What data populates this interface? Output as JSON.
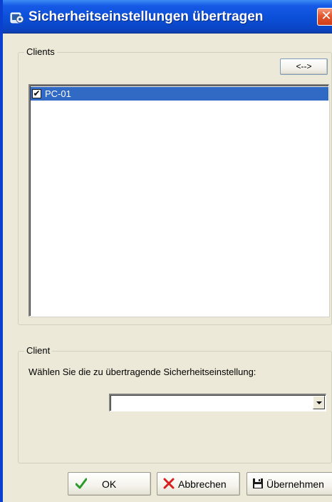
{
  "window": {
    "title": "Sicherheitseinstellungen übertragen",
    "close_glyph": "✕"
  },
  "clients_group": {
    "legend": "Clients",
    "swap_button_label": "<-->",
    "items": [
      {
        "label": "PC-01",
        "checked": true,
        "selected": true
      }
    ]
  },
  "client_group": {
    "legend": "Client",
    "prompt": "Wählen Sie die zu übertragende Sicherheitseinstellung:",
    "selected_value": ""
  },
  "buttons": {
    "ok_label": "OK",
    "cancel_label": "Abbrechen",
    "apply_label": "Übernehmen"
  },
  "colors": {
    "titlebar": "#0b4fd8",
    "selection": "#316ac5",
    "ok_icon": "#2a9b2a",
    "cancel_icon": "#d61f1f"
  },
  "icons": {
    "app": "app-icon",
    "ok": "check-icon",
    "cancel": "x-icon",
    "apply": "save-icon"
  }
}
